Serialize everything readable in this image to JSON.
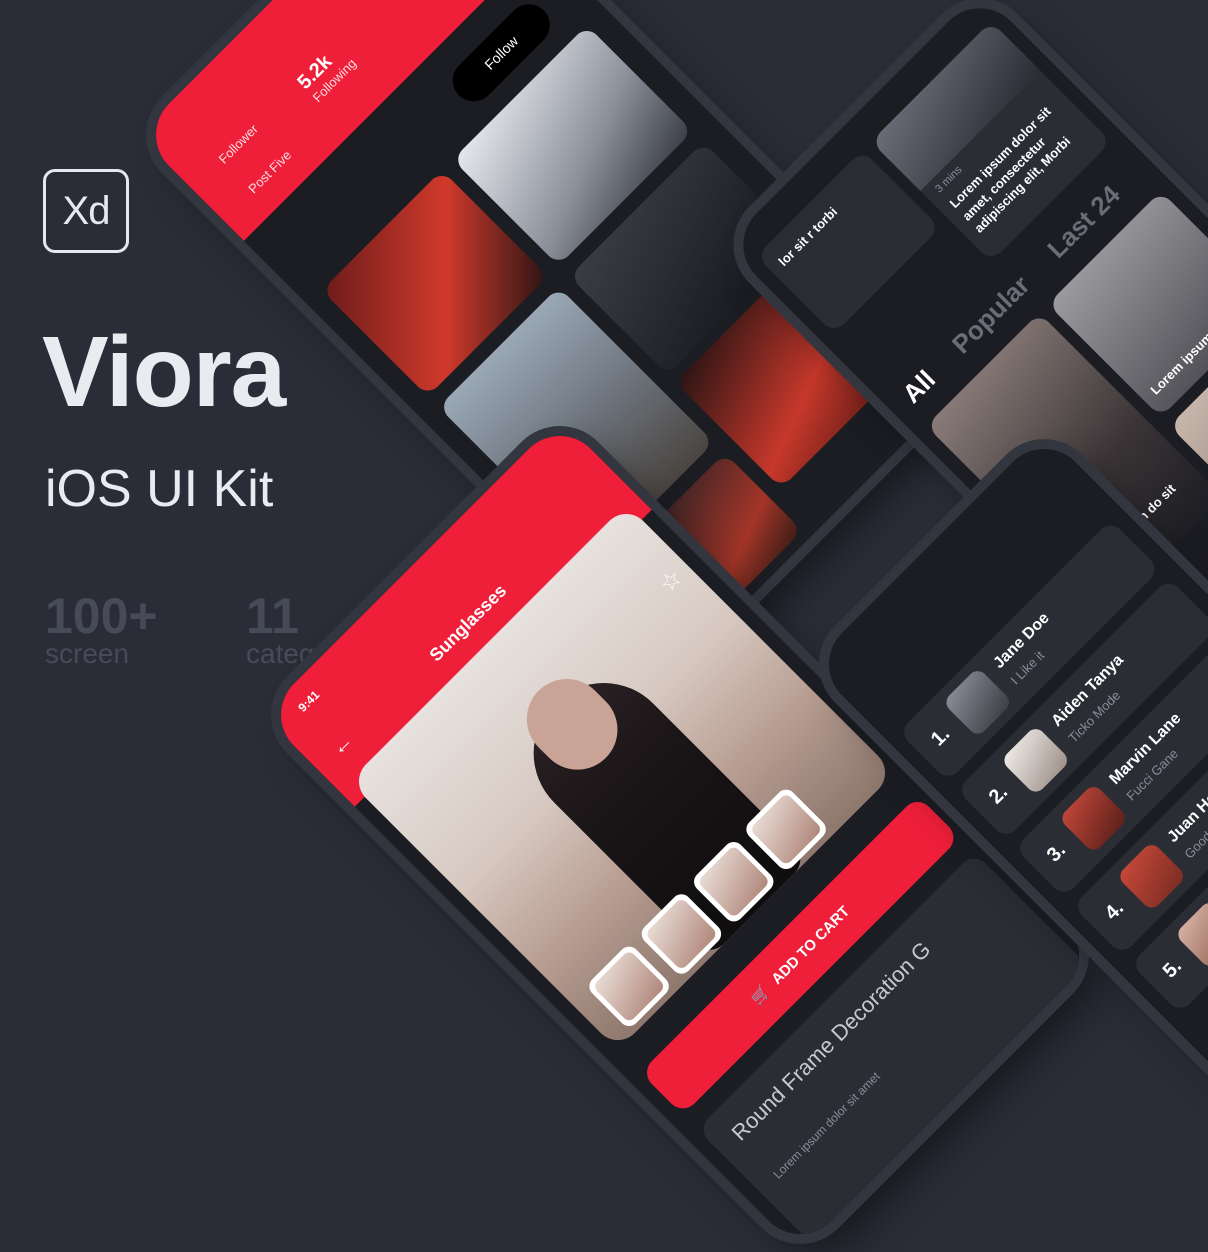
{
  "brand": {
    "logo_text": "Xd",
    "title": "Viora",
    "subtitle": "iOS UI Kit",
    "stats": [
      {
        "number": "100+",
        "label": "screen"
      },
      {
        "number": "11",
        "label": "category"
      }
    ]
  },
  "profile_screen": {
    "stats": [
      {
        "value": "",
        "label": "Follower"
      },
      {
        "value": "5.2k",
        "label": "Following"
      }
    ],
    "partial_label": "Post Five",
    "follow_button": "Follow"
  },
  "feed_screen": {
    "tabs": [
      "All",
      "Popular",
      "Last 24"
    ],
    "card_texts": [
      "lor sit r torbi",
      "Lorem ipsum dolor sit amet, consectetur adipiscing elit, Morbi",
      "Lorem ipsum do sit amet, cons",
      "Lorem ipsum"
    ],
    "meta": "3 mins"
  },
  "product_screen": {
    "time": "9:41",
    "title": "Sunglasses",
    "add_to_cart": "ADD TO CART",
    "product_name": "Round Frame Decoration G",
    "description": "Lorem ipsum dolor sit amet"
  },
  "leaderboard_screen": {
    "rows": [
      {
        "rank": "1.",
        "name": "Jane Doe",
        "subtitle": "I Like it"
      },
      {
        "rank": "2.",
        "name": "Aiden Tanya",
        "subtitle": "Ticko Mode"
      },
      {
        "rank": "3.",
        "name": "Marvin Lane",
        "subtitle": "Fucci Gane"
      },
      {
        "rank": "4.",
        "name": "Juan Herman",
        "subtitle": "Good Boy"
      },
      {
        "rank": "5.",
        "name": "",
        "subtitle": ""
      }
    ]
  },
  "colors": {
    "background": "#2a2d37",
    "accent": "#ef1f3a",
    "phone_body": "#16171d",
    "text_light": "#e9ebf0",
    "text_muted": "#474b57"
  },
  "icons": [
    "xd-logo",
    "message-icon",
    "back-arrow-icon",
    "star-icon",
    "cart-icon",
    "heart-icon",
    "wifi-icon"
  ]
}
